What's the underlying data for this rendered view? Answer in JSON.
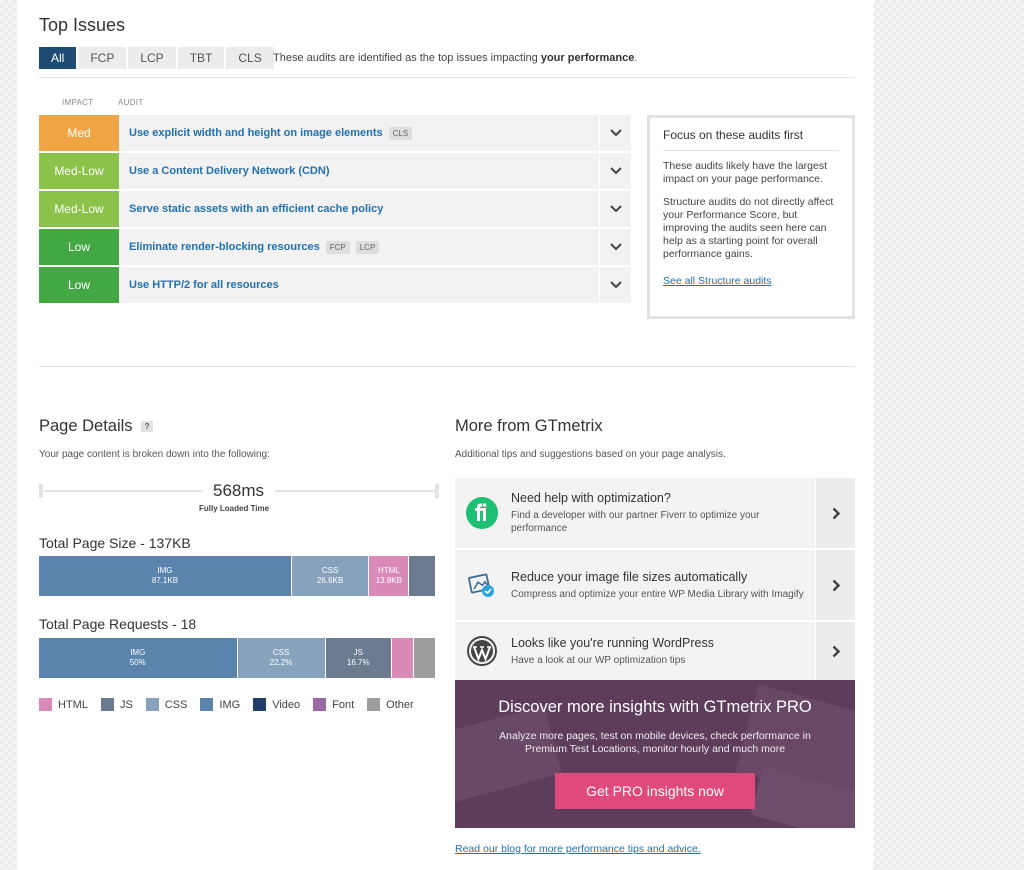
{
  "top_issues": {
    "title": "Top Issues",
    "tabs": [
      "All",
      "FCP",
      "LCP",
      "TBT",
      "CLS"
    ],
    "note_prefix": "These audits are identified as the top issues impacting ",
    "note_bold": "your performance",
    "note_suffix": ".",
    "col_impact": "IMPACT",
    "col_audit": "AUDIT",
    "rows": [
      {
        "impact": "Med",
        "title": "Use explicit width and height on image elements",
        "tags": [
          "CLS"
        ],
        "color": "#f0a544"
      },
      {
        "impact": "Med-Low",
        "title": "Use a Content Delivery Network (CDN)",
        "tags": [],
        "color": "#8bc34a"
      },
      {
        "impact": "Med-Low",
        "title": "Serve static assets with an efficient cache policy",
        "tags": [],
        "color": "#8bc34a"
      },
      {
        "impact": "Low",
        "title": "Eliminate render-blocking resources",
        "tags": [
          "FCP",
          "LCP"
        ],
        "color": "#43a743"
      },
      {
        "impact": "Low",
        "title": "Use HTTP/2 for all resources",
        "tags": [],
        "color": "#43a743"
      }
    ],
    "focus": {
      "title": "Focus on these audits first",
      "p1": "These audits likely have the largest impact on your page performance.",
      "p2": "Structure audits do not directly affect your Performance Score, but improving the audits seen here can help as a starting point for overall performance gains.",
      "link": "See all Structure audits"
    }
  },
  "page_details": {
    "title": "Page Details",
    "help": "?",
    "subtitle": "Your page content is broken down into the following:",
    "fully_loaded_value": "568ms",
    "fully_loaded_label": "Fully Loaded Time",
    "size_title": "Total Page Size - 137KB",
    "size_segments": [
      {
        "label": "IMG",
        "value": "87.1KB",
        "share": 0.637,
        "color": "#5b84ad"
      },
      {
        "label": "CSS",
        "value": "26.6KB",
        "share": 0.195,
        "color": "#86a2bd"
      },
      {
        "label": "HTML",
        "value": "13.8KB",
        "share": 0.101,
        "color": "#d98ab9"
      },
      {
        "label": "",
        "value": "",
        "share": 0.067,
        "color": "#6b7c91"
      }
    ],
    "requests_title": "Total Page Requests - 18",
    "request_segments": [
      {
        "label": "IMG",
        "value": "50%",
        "share": 0.5,
        "color": "#5b84ad"
      },
      {
        "label": "CSS",
        "value": "22.2%",
        "share": 0.222,
        "color": "#86a2bd"
      },
      {
        "label": "JS",
        "value": "16.7%",
        "share": 0.167,
        "color": "#6b7c91"
      },
      {
        "label": "",
        "value": "",
        "share": 0.056,
        "color": "#d98ab9"
      },
      {
        "label": "",
        "value": "",
        "share": 0.055,
        "color": "#9d9d9d"
      }
    ],
    "legend": [
      {
        "label": "HTML",
        "color": "#d98ab9"
      },
      {
        "label": "JS",
        "color": "#6b7c91"
      },
      {
        "label": "CSS",
        "color": "#86a2bd"
      },
      {
        "label": "IMG",
        "color": "#5b84ad"
      },
      {
        "label": "Video",
        "color": "#1f3f66"
      },
      {
        "label": "Font",
        "color": "#9b6aa6"
      },
      {
        "label": "Other",
        "color": "#9d9d9d"
      }
    ]
  },
  "more": {
    "title": "More from GTmetrix",
    "subtitle": "Additional tips and suggestions based on your page analysis.",
    "cards": [
      {
        "icon": "fiverr-icon",
        "title": "Need help with optimization?",
        "desc": "Find a developer with our partner Fiverr to optimize your performance"
      },
      {
        "icon": "imagify-icon",
        "title": "Reduce your image file sizes automatically",
        "desc": "Compress and optimize your entire WP Media Library with Imagify"
      },
      {
        "icon": "wordpress-icon",
        "title": "Looks like you're running WordPress",
        "desc": "Have a look at our WP optimization tips"
      }
    ],
    "pro": {
      "title": "Discover more insights with GTmetrix PRO",
      "desc": "Analyze more pages, test on mobile devices, check performance in Premium Test Locations, monitor hourly and much more",
      "button": "Get PRO insights now"
    },
    "blog_link": "Read our blog for more performance tips and advice."
  }
}
